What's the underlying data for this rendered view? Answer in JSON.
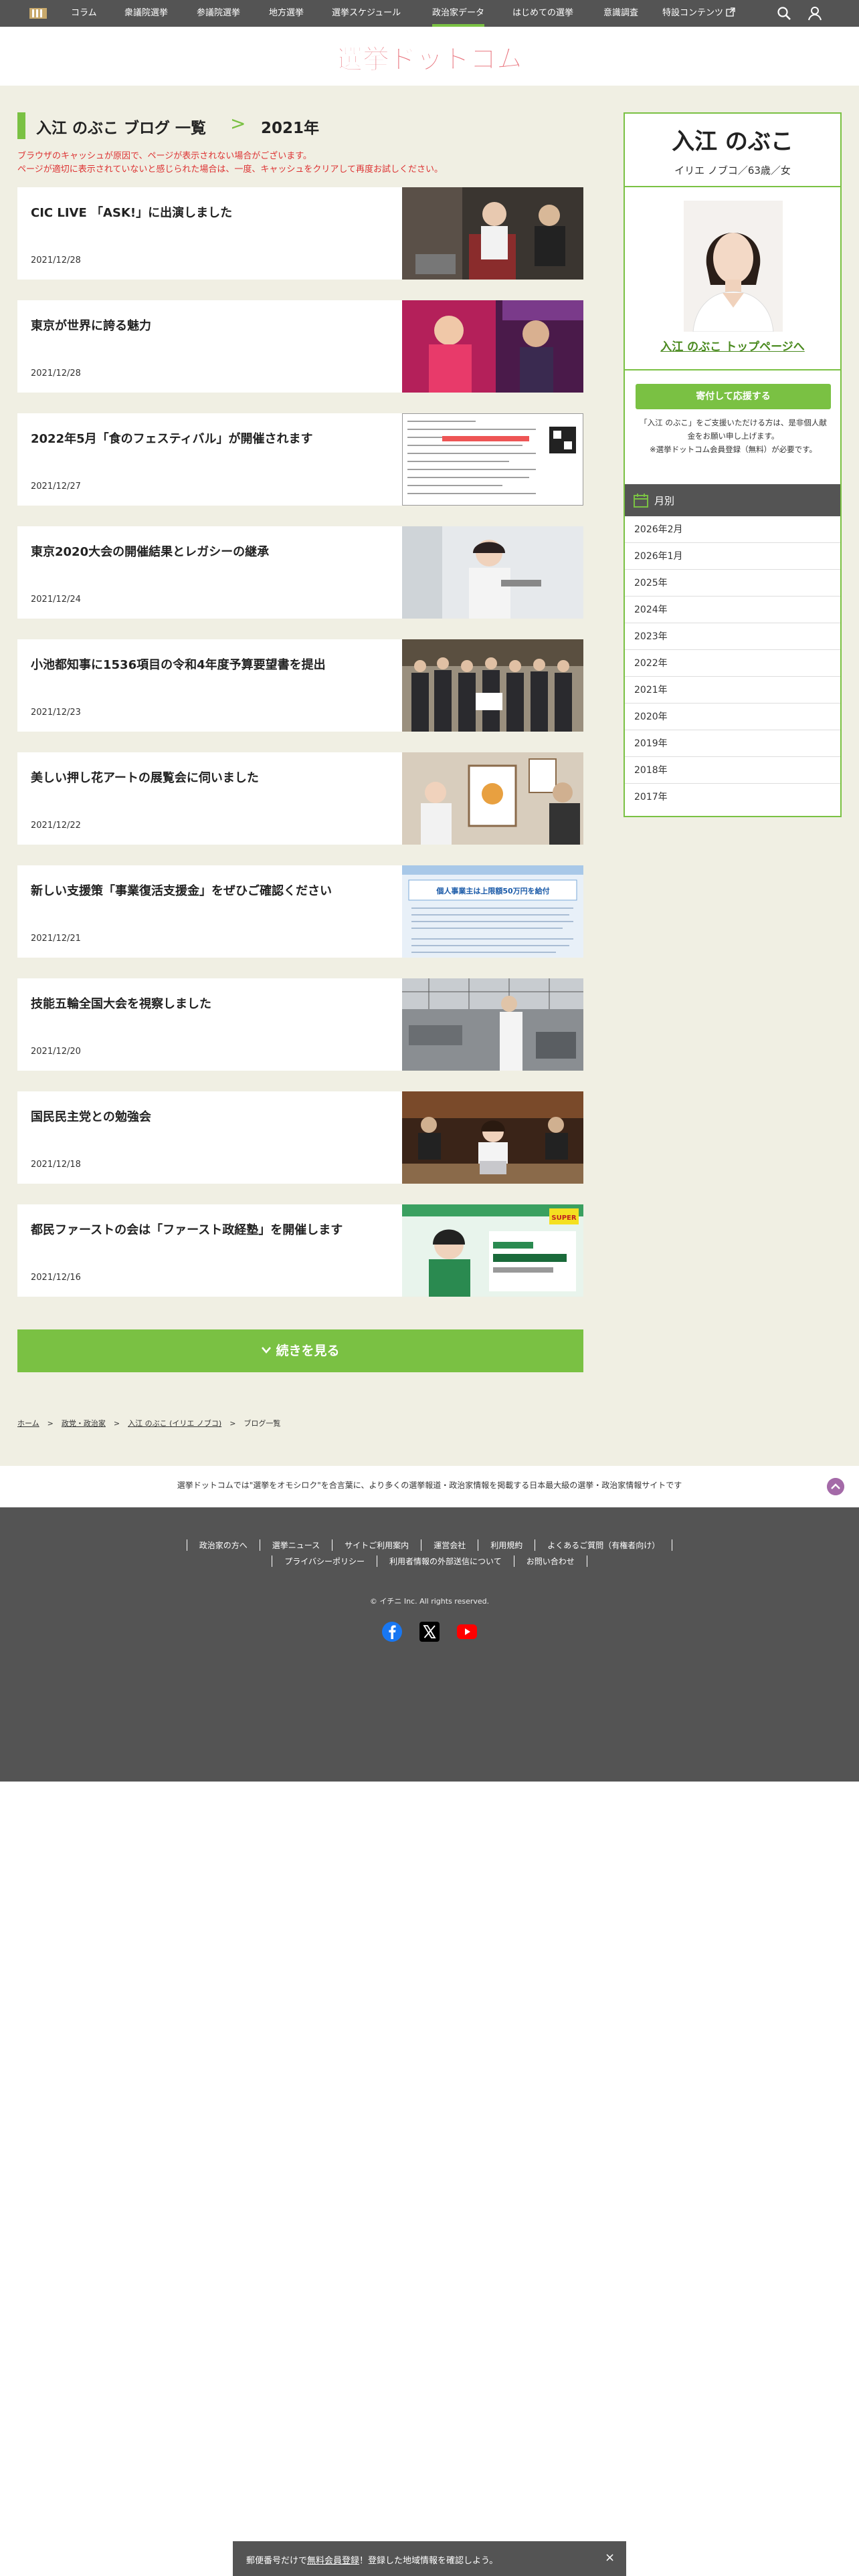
{
  "nav": {
    "items": [
      "コラム",
      "衆議院選挙",
      "参議院選挙",
      "地方選挙",
      "選挙スケジュール",
      "政治家データ",
      "はじめての選挙",
      "意識調査",
      "特設コンテンツ"
    ],
    "active_index": 5
  },
  "header": {
    "logo_text": "選挙ドットコム"
  },
  "blog": {
    "name": "入江 のぶこ ブログ 一覧",
    "separator": ">",
    "year": "2021年",
    "notice_1": "ブラウザのキャッシュが原因で、ページが表示されない場合がございます。",
    "notice_2": "ページが適切に表示されていないと感じられた場合は、一度、キャッシュをクリアして再度お試しください。"
  },
  "posts": [
    {
      "title": "CIC LIVE 「ASK!」に出演しました",
      "date": "2021/12/28"
    },
    {
      "title": "東京が世界に誇る魅力",
      "date": "2021/12/28"
    },
    {
      "title": "2022年5月「食のフェスティバル」が開催されます",
      "date": "2021/12/27"
    },
    {
      "title": "東京2020大会の開催結果とレガシーの継承",
      "date": "2021/12/24"
    },
    {
      "title": "小池都知事に1536項目の令和4年度予算要望書を提出",
      "date": "2021/12/23"
    },
    {
      "title": "美しい押し花アートの展覧会に伺いました",
      "date": "2021/12/22"
    },
    {
      "title": "新しい支援策「事業復活支援金」をぜひご確認ください",
      "date": "2021/12/21"
    },
    {
      "title": "技能五輪全国大会を視察しました",
      "date": "2021/12/20"
    },
    {
      "title": "国民民主党との勉強会",
      "date": "2021/12/18"
    },
    {
      "title": "都民ファーストの会は「ファースト政経塾」を開催します",
      "date": "2021/12/16"
    }
  ],
  "thumb_text": {
    "t7_title": "個人事業主は上限額50万円を給付",
    "t10_badge": "SUPER"
  },
  "more_label": "続きを見る",
  "breadcrumb": [
    "ホーム",
    "政党・政治家",
    "入江 のぶこ (イリエ ノブコ)",
    "ブログ一覧"
  ],
  "sidebar": {
    "name": "入江 のぶこ",
    "kana": "イリエ ノブコ／63歳／女",
    "top_link": "入江 のぶこ トップページへ",
    "donate_label": "寄付して応援する",
    "donate_note_1": "「入江 のぶこ」をご支援いただける方は、是非個人献",
    "donate_note_2": "金をお願い申し上げます。",
    "donate_note_3": "※選挙ドットコム会員登録（無料）が必要です。",
    "month_title": "月別",
    "months": [
      "2026年2月",
      "2026年1月",
      "2025年",
      "2024年",
      "2023年",
      "2022年",
      "2021年",
      "2020年",
      "2019年",
      "2018年",
      "2017年"
    ]
  },
  "footer": {
    "tagline": "選挙ドットコムでは\"選挙をオモシロク\"を合言葉に、より多くの選挙報道・政治家情報を掲載する日本最大級の選挙・政治家情報サイトです",
    "links_row1": [
      "政治家の方へ",
      "選挙ニュース",
      "サイトご利用案内",
      "運営会社",
      "利用規約",
      "よくあるご質問（有権者向け）"
    ],
    "links_row2": [
      "プライバシーポリシー",
      "利用者情報の外部送信について",
      "お問い合わせ"
    ],
    "copyright": "© イチニ Inc. All rights reserved."
  },
  "banner": {
    "text_before": "郵便番号だけで",
    "text_link": "無料会員登録",
    "text_after": "！登録した地域情報を確認しよう。",
    "close": "×"
  },
  "colors": {
    "accent": "#7ac143",
    "dark": "#545454",
    "beige": "#f0efe3",
    "notice": "#dd3333"
  }
}
